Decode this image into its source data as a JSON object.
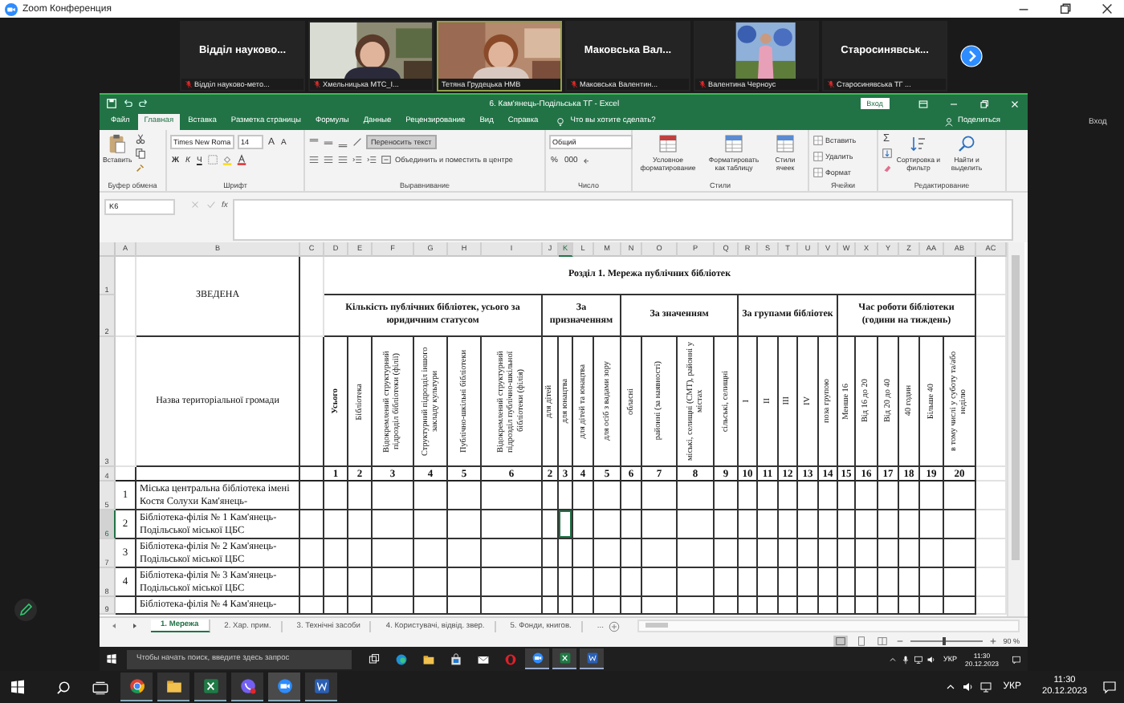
{
  "zoom_window": {
    "title": "Zoom Конференция"
  },
  "participants": [
    {
      "kind": "name",
      "display": "Відділ науково...",
      "caption": "Відділ науково-мето...",
      "muted": true,
      "active": false
    },
    {
      "kind": "video",
      "caption": "Хмельницька МТС_І...",
      "muted": true,
      "active": false
    },
    {
      "kind": "video",
      "caption": "Тетяна Грудецька НМВ",
      "muted": false,
      "active": true
    },
    {
      "kind": "name",
      "display": "Маковська Вал...",
      "caption": "Маковська Валентин...",
      "muted": true,
      "active": false
    },
    {
      "kind": "portrait",
      "caption": "Валентина Черноус",
      "muted": true,
      "active": false
    },
    {
      "kind": "name",
      "display": "Старосинявськ...",
      "caption": "Старосинявська ТГ ...",
      "muted": true,
      "active": false
    }
  ],
  "side_label": "Вход",
  "excel": {
    "title": "6. Кам'янець-Подільська ТГ  -  Excel",
    "login": "Вход",
    "tabs": [
      {
        "label": "Файл",
        "selected": false
      },
      {
        "label": "Главная",
        "selected": true
      },
      {
        "label": "Вставка",
        "selected": false
      },
      {
        "label": "Разметка страницы",
        "selected": false
      },
      {
        "label": "Формулы",
        "selected": false
      },
      {
        "label": "Данные",
        "selected": false
      },
      {
        "label": "Рецензирование",
        "selected": false
      },
      {
        "label": "Вид",
        "selected": false
      },
      {
        "label": "Справка",
        "selected": false
      }
    ],
    "tell_me": "Что вы хотите сделать?",
    "share": "Поделиться",
    "ribbon": {
      "clipboard": {
        "paste": "Вставить",
        "label": "Буфер обмена"
      },
      "font": {
        "name": "Times New Roma",
        "size": "14",
        "grow": "A",
        "shrink": "A",
        "bold": "Ж",
        "italic": "К",
        "underline": "Ч",
        "label": "Шрифт"
      },
      "alignment": {
        "wrap": "Переносить текст",
        "wrap_on": true,
        "merge": "Объединить и поместить в центре",
        "label": "Выравнивание"
      },
      "number": {
        "format": "Общий",
        "percent": "%",
        "thousands": "000",
        "label": "Число"
      },
      "styles": {
        "buttons": [
          "Условное форматирование",
          "Форматировать как таблицу",
          "Стили ячеек"
        ],
        "label": "Стили"
      },
      "cells": {
        "buttons": [
          "Вставить",
          "Удалить",
          "Формат"
        ],
        "label": "Ячейки"
      },
      "editing": {
        "sum": "Σ",
        "buttons": [
          "Сортировка и фильтр",
          "Найти и выделить"
        ],
        "label": "Редактирование"
      }
    },
    "name_box": "K6",
    "formula_icon": "fx",
    "sheet": {
      "columns": [
        {
          "letter": "A",
          "selected": false
        },
        {
          "letter": "B",
          "selected": false
        },
        {
          "letter": "C",
          "selected": false
        },
        {
          "letter": "D",
          "selected": false
        },
        {
          "letter": "E",
          "selected": false
        },
        {
          "letter": "F",
          "selected": false
        },
        {
          "letter": "G",
          "selected": false
        },
        {
          "letter": "H",
          "selected": false
        },
        {
          "letter": "I",
          "selected": false
        },
        {
          "letter": "J",
          "selected": false
        },
        {
          "letter": "K",
          "selected": true
        },
        {
          "letter": "L",
          "selected": false
        },
        {
          "letter": "M",
          "selected": false
        },
        {
          "letter": "N",
          "selected": false
        },
        {
          "letter": "O",
          "selected": false
        },
        {
          "letter": "P",
          "selected": false
        },
        {
          "letter": "Q",
          "selected": false
        },
        {
          "letter": "R",
          "selected": false
        },
        {
          "letter": "S",
          "selected": false
        },
        {
          "letter": "T",
          "selected": false
        },
        {
          "letter": "U",
          "selected": false
        },
        {
          "letter": "V",
          "selected": false
        },
        {
          "letter": "W",
          "selected": false
        },
        {
          "letter": "X",
          "selected": false
        },
        {
          "letter": "Y",
          "selected": false
        },
        {
          "letter": "Z",
          "selected": false
        },
        {
          "letter": "AA",
          "selected": false
        },
        {
          "letter": "AB",
          "selected": false
        },
        {
          "letter": "AC",
          "selected": false
        }
      ],
      "row_headers": [
        {
          "label": "1",
          "selected": false
        },
        {
          "label": "2",
          "selected": false
        },
        {
          "label": "3",
          "selected": false
        },
        {
          "label": "4",
          "selected": false
        },
        {
          "label": "5",
          "selected": false
        },
        {
          "label": "6",
          "selected": true
        },
        {
          "label": "7",
          "selected": false
        },
        {
          "label": "8",
          "selected": false
        },
        {
          "label": "9",
          "selected": false
        }
      ],
      "summary_label": "ЗВЕДЕНА",
      "section_title": "Розділ 1. Мережа публічних бібліотек",
      "name_heading": "Назва територіальної громади",
      "groups": [
        {
          "title": "Кількість публічних бібліотек, усього за юридичним статусом",
          "columns": [
            {
              "heading": "Усього",
              "number": "1",
              "bold": true
            },
            {
              "heading": "Бібліотека",
              "number": "2",
              "bold": false
            },
            {
              "heading": "Відокремлений структурний підрозділ бібліотеки (філії)",
              "number": "3",
              "bold": false
            },
            {
              "heading": "Структурний підрозділ іншого закладу культури",
              "number": "4",
              "bold": false
            },
            {
              "heading": "Публічно-шкільні бібліотеки",
              "number": "5",
              "bold": false
            },
            {
              "heading": "Відокремлений структурний підрозділ публічно-шкільної бібліотеки (філія)",
              "number": "6",
              "bold": false
            }
          ]
        },
        {
          "title": "За призначенням",
          "columns": [
            {
              "heading": "для дітей",
              "number": "2",
              "bold": false
            },
            {
              "heading": "для юнацтва",
              "number": "3",
              "bold": false
            },
            {
              "heading": "для дітей та юнацтва",
              "number": "4",
              "bold": false
            },
            {
              "heading": "для осіб з вадами зору",
              "number": "5",
              "bold": false
            }
          ]
        },
        {
          "title": "За значенням",
          "columns": [
            {
              "heading": "обласні",
              "number": "6",
              "bold": false
            },
            {
              "heading": "районні (за наявності)",
              "number": "7",
              "bold": false
            },
            {
              "heading": "міські, селищні (СМТ), районні у містах",
              "number": "8",
              "bold": false
            },
            {
              "heading": "сільські, селищні",
              "number": "9",
              "bold": false
            }
          ]
        },
        {
          "title": "За групами бібліотек",
          "columns": [
            {
              "heading": "I",
              "number": "10",
              "bold": false
            },
            {
              "heading": "II",
              "number": "11",
              "bold": false
            },
            {
              "heading": "III",
              "number": "12",
              "bold": false
            },
            {
              "heading": "IV",
              "number": "13",
              "bold": false
            },
            {
              "heading": "поза групою",
              "number": "14",
              "bold": false
            }
          ]
        },
        {
          "title": "Час роботи бібліотеки (години на тиждень)",
          "columns": [
            {
              "heading": "Менше 16",
              "number": "15",
              "bold": false
            },
            {
              "heading": "Від 16 до 20",
              "number": "16",
              "bold": false
            },
            {
              "heading": "Від 20 до 40",
              "number": "17",
              "bold": false
            },
            {
              "heading": "40 годин",
              "number": "18",
              "bold": false
            },
            {
              "heading": "Більше 40",
              "number": "19",
              "bold": false
            },
            {
              "heading": "в тому числі у суботу та/або неділю",
              "number": "20",
              "bold": false
            }
          ]
        }
      ],
      "rows": [
        {
          "number": "1",
          "name": "Міська центральна  бібліотека імені Костя Солухи Кам'янець-"
        },
        {
          "number": "2",
          "name": "Бібліотека-філія № 1 Кам'янець-Подільської міської ЦБС"
        },
        {
          "number": "3",
          "name": "Бібліотека-філія № 2 Кам'янець-Подільської міської ЦБС"
        },
        {
          "number": "4",
          "name": "Бібліотека-філія № 3 Кам'янець-Подільської міської ЦБС"
        },
        {
          "name": "Бібліотека-філія № 4 Кам'янець-"
        }
      ]
    },
    "sheet_tabs": [
      {
        "label": "1. Мережа",
        "selected": true
      },
      {
        "label": "2. Хар. прим.",
        "selected": false
      },
      {
        "label": "3. Технічні засоби",
        "selected": false
      },
      {
        "label": "4. Користувачі, відвід. звер.",
        "selected": false
      },
      {
        "label": "5. Фонди, книгов.",
        "selected": false
      }
    ],
    "more_tabs": "...",
    "zoom": {
      "level": 0.45,
      "reading": "90 %"
    }
  },
  "inner_taskbar": {
    "search": {
      "placeholder": "Чтобы начать поиск, введите здесь запрос"
    },
    "apps": [
      {
        "kind": "taskview",
        "running": false
      },
      {
        "kind": "edge",
        "running": false
      },
      {
        "kind": "explorer",
        "running": false
      },
      {
        "kind": "store",
        "running": false
      },
      {
        "kind": "mail",
        "running": false
      },
      {
        "kind": "opera",
        "running": false
      },
      {
        "kind": "zoom",
        "running": true
      },
      {
        "kind": "excel",
        "running": true
      },
      {
        "kind": "word",
        "running": true
      }
    ],
    "language": "УКР",
    "time": "11:30",
    "date": "20.12.2023"
  },
  "taskbar": {
    "apps": [
      {
        "kind": "search",
        "running": false,
        "selected": false
      },
      {
        "kind": "taskview",
        "running": false,
        "selected": false
      },
      {
        "kind": "chrome",
        "running": true,
        "selected": false
      },
      {
        "kind": "explorer",
        "running": true,
        "selected": false
      },
      {
        "kind": "excel",
        "running": true,
        "selected": false
      },
      {
        "kind": "viber",
        "running": true,
        "selected": false
      },
      {
        "kind": "zoom",
        "running": true,
        "selected": true
      },
      {
        "kind": "word",
        "running": true,
        "selected": false
      }
    ],
    "language": "УКР",
    "time": "11:30",
    "date": "20.12.2023"
  }
}
